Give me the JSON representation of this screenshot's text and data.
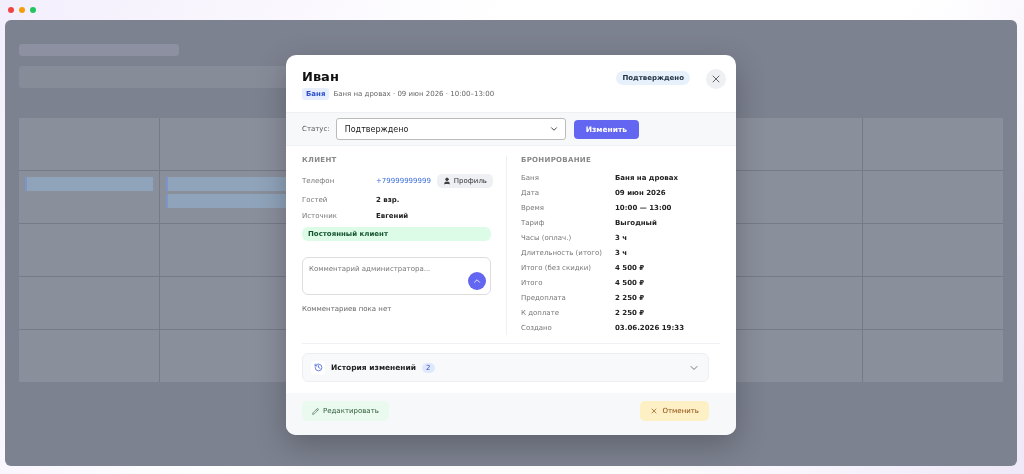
{
  "modal": {
    "title": "Иван",
    "tag": "Баня",
    "subtitle": "Баня на дровах · 09 июн 2026 · 10:00–13:00",
    "status_badge": "Подтверждено",
    "status_row": {
      "label": "Статус:",
      "value": "Подтверждено",
      "button": "Изменить"
    },
    "client": {
      "heading": "КЛИЕНТ",
      "rows": [
        {
          "label": "Телефон",
          "value": "+79999999999",
          "kind": "link"
        },
        {
          "label": "Гостей",
          "value": "2 взр.",
          "kind": "text"
        },
        {
          "label": "Источник",
          "value": "Евгений",
          "kind": "text"
        }
      ],
      "profile_button": "Профиль",
      "regular_badge": "Постоянный клиент",
      "comment": {
        "placeholder": "Комментарий администратора..."
      },
      "no_comments": "Комментариев пока нет"
    },
    "booking": {
      "heading": "БРОНИРОВАНИЕ",
      "rows": [
        {
          "label": "Баня",
          "value": "Баня на дровах"
        },
        {
          "label": "Дата",
          "value": "09 июн 2026"
        },
        {
          "label": "Время",
          "value": "10:00 — 13:00"
        },
        {
          "label": "Тариф",
          "value": "Выгодный"
        },
        {
          "label": "Часы (оплач.)",
          "value": "3 ч"
        },
        {
          "label": "Длительность (итого)",
          "value": "3 ч"
        },
        {
          "label": "Итого (без скидки)",
          "value": "4 500 ₽"
        },
        {
          "label": "Итого",
          "value": "4 500 ₽"
        },
        {
          "label": "Предоплата",
          "value": "2 250 ₽"
        },
        {
          "label": "К доплате",
          "value": "2 250 ₽"
        },
        {
          "label": "Создано",
          "value": "03.06.2026 19:33"
        }
      ]
    },
    "history": {
      "title": "История изменений",
      "count": "2",
      "expanded": false
    },
    "footer": {
      "edit": "Редактировать",
      "cancel": "Отменить"
    }
  }
}
